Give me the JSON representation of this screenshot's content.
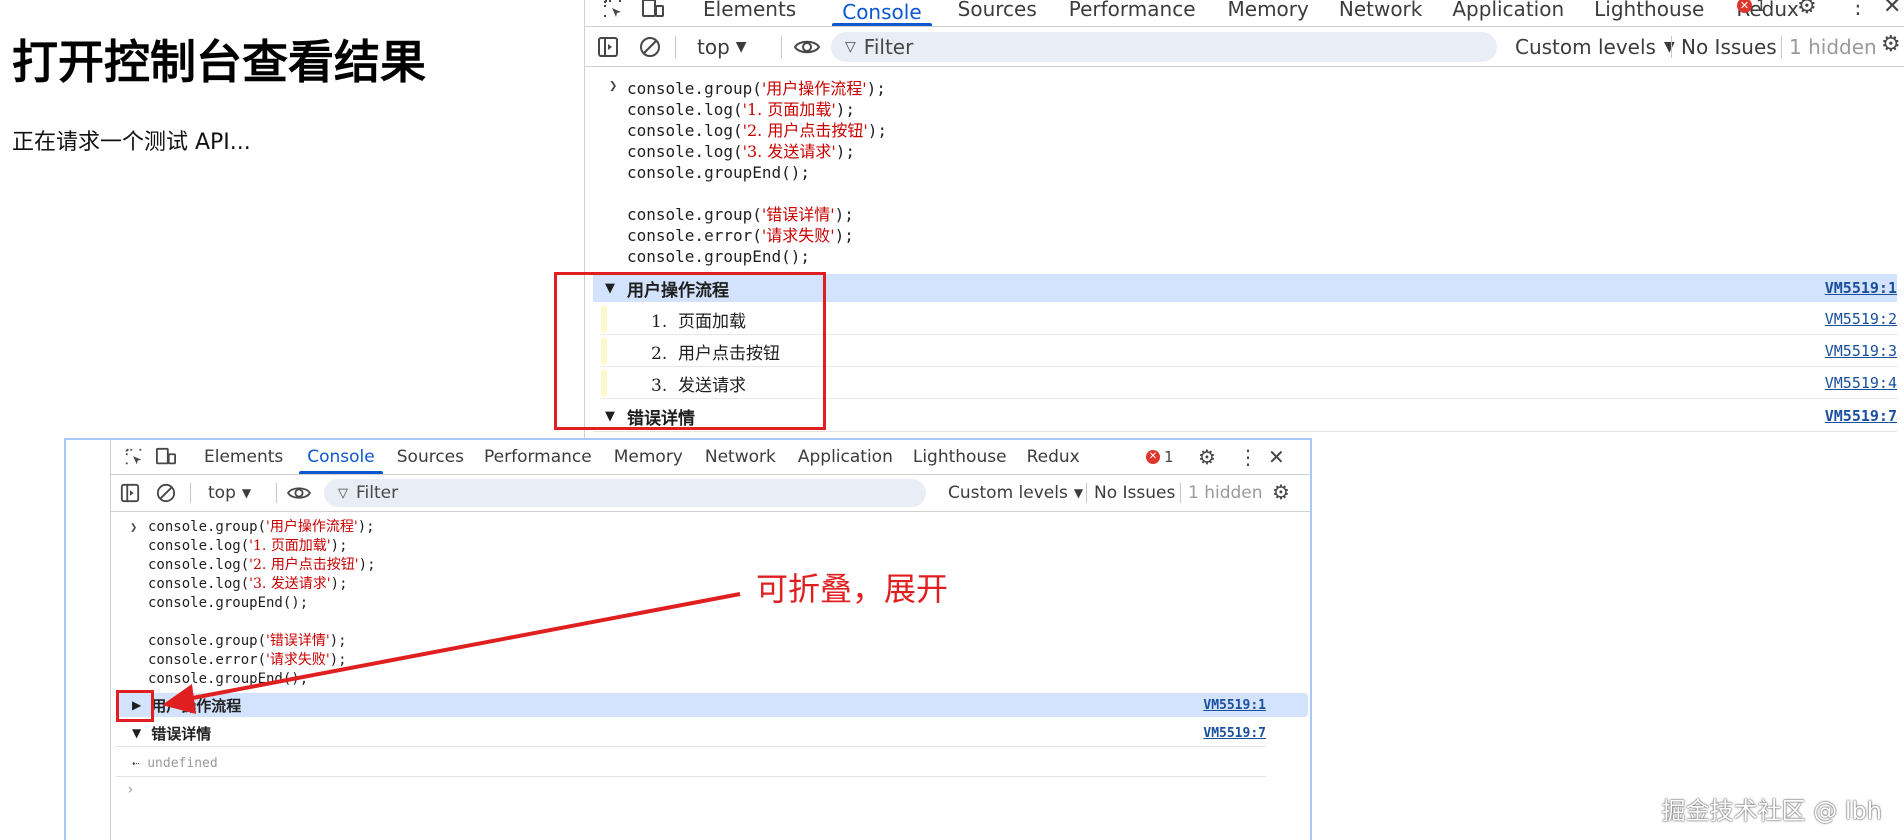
{
  "page": {
    "title": "打开控制台查看结果",
    "text": "正在请求一个测试 API..."
  },
  "devtools_top": {
    "tabs": [
      "Elements",
      "Console",
      "Sources",
      "Performance",
      "Memory",
      "Network",
      "Application",
      "Lighthouse",
      "Redux"
    ],
    "active_tab": "Console",
    "error_count": "1",
    "context": "top",
    "filter_placeholder": "Filter",
    "levels": "Custom levels",
    "issues": "No Issues",
    "hidden": "1 hidden",
    "code": [
      "console.group('用户操作流程');",
      "console.log('1. 页面加载');",
      "console.log('2. 用户点击按钮');",
      "console.log('3. 发送请求');",
      "console.groupEnd();",
      "",
      "console.group('错误详情');",
      "console.error('请求失败');",
      "console.groupEnd();"
    ],
    "group1": {
      "label": "用户操作流程",
      "source": "VM5519:1",
      "expanded": true
    },
    "logs": [
      {
        "text": "1.  页面加载",
        "source": "VM5519:2"
      },
      {
        "text": "2.  用户点击按钮",
        "source": "VM5519:3"
      },
      {
        "text": "3.  发送请求",
        "source": "VM5519:4"
      }
    ],
    "group2": {
      "label": "错误详情",
      "source": "VM5519:7",
      "expanded": true
    }
  },
  "devtools_bottom": {
    "tabs": [
      "Elements",
      "Console",
      "Sources",
      "Performance",
      "Memory",
      "Network",
      "Application",
      "Lighthouse",
      "Redux"
    ],
    "active_tab": "Console",
    "error_count": "1",
    "context": "top",
    "filter_placeholder": "Filter",
    "levels": "Custom levels",
    "issues": "No Issues",
    "hidden": "1 hidden",
    "code": [
      "console.group('用户操作流程');",
      "console.log('1. 页面加载');",
      "console.log('2. 用户点击按钮');",
      "console.log('3. 发送请求');",
      "console.groupEnd();",
      "",
      "console.group('错误详情');",
      "console.error('请求失败');",
      "console.groupEnd();"
    ],
    "group1": {
      "label": "用户操作流程",
      "source": "VM5519:1",
      "expanded": false
    },
    "group2": {
      "label": "错误详情",
      "source": "VM5519:7",
      "expanded": true
    },
    "result": "undefined"
  },
  "annotation": "可折叠，展开",
  "watermark": "掘金技术社区 @ lbh",
  "colors": {
    "accent": "#0b57d0",
    "annotation": "#e02020",
    "group_highlight": "#d3e3fd",
    "error": "#dc362e"
  }
}
